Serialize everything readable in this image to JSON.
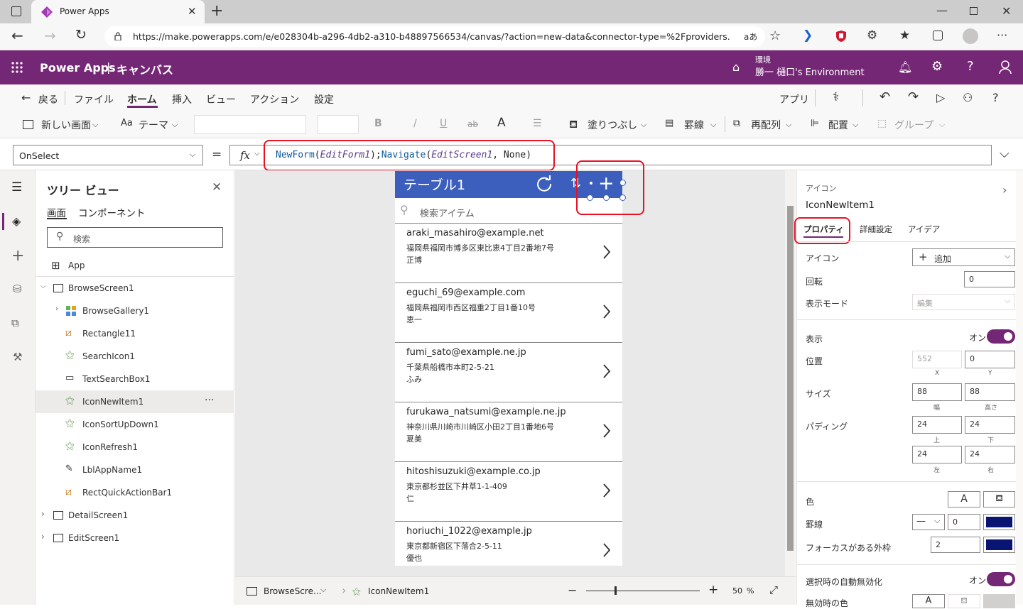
{
  "browser": {
    "tab_title": "Power Apps",
    "url": "https://make.powerapps.com/e/e028304b-a296-4db2-a310-b48897566534/canvas/?action=new-data&connector-type=%2Fproviders...",
    "reader_label": "aあ"
  },
  "header": {
    "app_name": "Power Apps",
    "separator": "|",
    "section": "キャンバス",
    "env_label": "環境",
    "env_name": "勝一 樋口's Environment"
  },
  "menu": {
    "back": "戻る",
    "file": "ファイル",
    "home": "ホーム",
    "insert": "挿入",
    "view": "ビュー",
    "action": "アクション",
    "settings": "設定",
    "app": "アプリ"
  },
  "toolbar": {
    "new_screen": "新しい画面",
    "theme": "テーマ",
    "fill": "塗りつぶし",
    "border": "罫線",
    "reorder": "再配列",
    "align": "配置",
    "group": "グループ",
    "bold": "B",
    "italic": "/",
    "underline": "U",
    "strike": "ab",
    "font_color": "A"
  },
  "formula": {
    "property": "OnSelect",
    "equals": "=",
    "fx": "fx",
    "tokens": {
      "f1": "NewForm",
      "p1": "(",
      "a1": "EditForm1",
      "p2": ");",
      "f2": "Navigate",
      "p3": "(",
      "a2": "EditScreen1",
      "p4": ", None)"
    }
  },
  "tree": {
    "title": "ツリー ビュー",
    "tab_screens": "画面",
    "tab_components": "コンポーネント",
    "search_placeholder": "検索",
    "items": [
      "App",
      "BrowseScreen1",
      "BrowseGallery1",
      "Rectangle11",
      "SearchIcon1",
      "TextSearchBox1",
      "IconNewItem1",
      "IconSortUpDown1",
      "IconRefresh1",
      "LblAppName1",
      "RectQuickActionBar1",
      "DetailScreen1",
      "EditScreen1"
    ],
    "more": "···"
  },
  "phone": {
    "title": "テーブル1",
    "search_placeholder": "検索アイテム",
    "records": [
      {
        "email": "araki_masahiro@example.net",
        "address": "福岡県福岡市博多区東比恵4丁目2番地7号",
        "name": "正博"
      },
      {
        "email": "eguchi_69@example.com",
        "address": "福岡県福岡市西区福重2丁目1番10号",
        "name": "恵一"
      },
      {
        "email": "fumi_sato@example.ne.jp",
        "address": "千葉県船橋市本町2-5-21",
        "name": "ふみ"
      },
      {
        "email": "furukawa_natsumi@example.ne.jp",
        "address": "神奈川県川崎市川崎区小田2丁目1番地6号",
        "name": "夏美"
      },
      {
        "email": "hitoshisuzuki@example.co.jp",
        "address": "東京都杉並区下井草1-1-409",
        "name": "仁"
      },
      {
        "email": "horiuchi_1022@example.jp",
        "address": "東京都新宿区下落合2-5-11",
        "name": "優也"
      }
    ]
  },
  "status": {
    "screen": "BrowseScre...",
    "control": "IconNewItem1",
    "zoom": "50",
    "zoom_unit": "%"
  },
  "props": {
    "type_label": "アイコン",
    "control_name": "IconNewItem1",
    "tab_properties": "プロパティ",
    "tab_advanced": "詳細設定",
    "tab_ideas": "アイデア",
    "icon_label": "アイコン",
    "icon_value": "追加",
    "rotation_label": "回転",
    "rotation_value": "0",
    "display_mode_label": "表示モード",
    "display_mode_value": "編集",
    "visible_label": "表示",
    "visible_value": "オン",
    "position_label": "位置",
    "pos_x": "552",
    "pos_y": "0",
    "x_cap": "X",
    "y_cap": "Y",
    "size_label": "サイズ",
    "width": "88",
    "height": "88",
    "width_cap": "幅",
    "height_cap": "高さ",
    "padding_label": "パディング",
    "pad_top": "24",
    "pad_bottom": "24",
    "pad_left": "24",
    "pad_right": "24",
    "top_cap": "上",
    "bottom_cap": "下",
    "left_cap": "左",
    "right_cap": "右",
    "color_label": "色",
    "color_a": "A",
    "border_label": "罫線",
    "border_value": "0",
    "focus_border_label": "フォーカスがある外枠",
    "focus_border_value": "2",
    "auto_disable_label": "選択時の自動無効化",
    "auto_disable_value": "オン",
    "disabled_color_label": "無効時の色",
    "border_color": "#0a1473"
  }
}
